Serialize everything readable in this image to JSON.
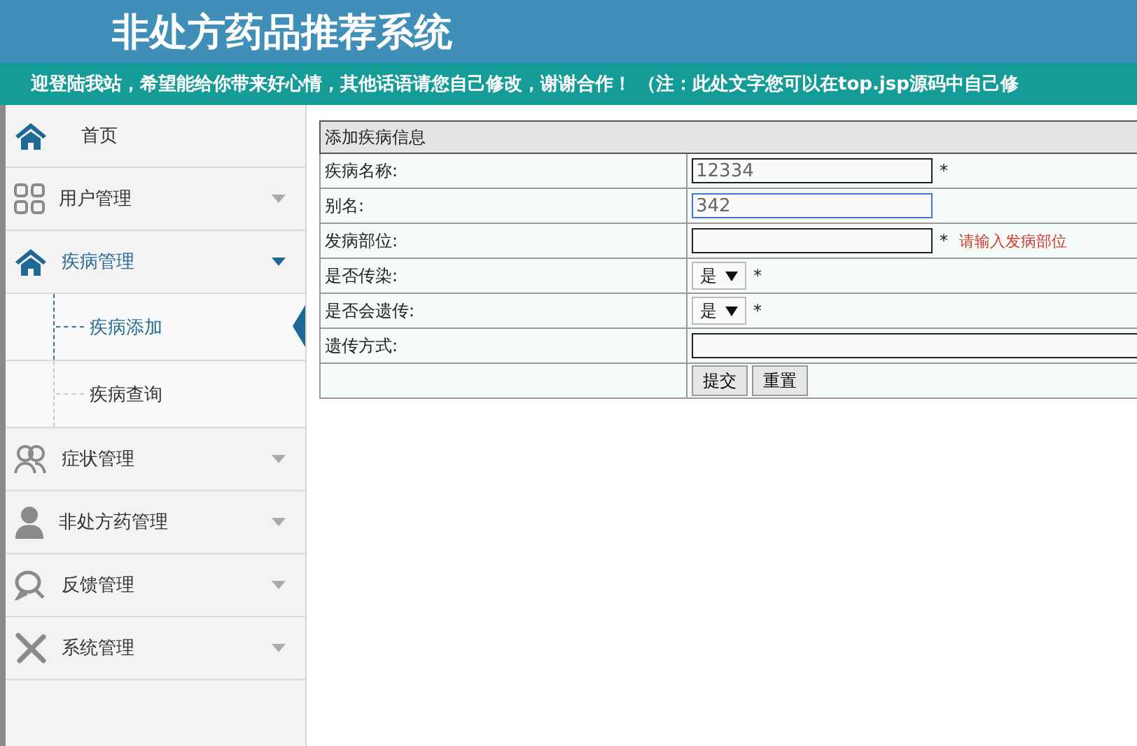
{
  "header": {
    "title": "非处方药品推荐系统",
    "notice": "迎登陆我站，希望能给你带来好心情，其他话语请您自己修改，谢谢合作！ （注：此处文字您可以在top.jsp源码中自己修"
  },
  "sidebar": {
    "items": [
      {
        "kind": "link",
        "label": "首页"
      },
      {
        "kind": "group",
        "label": "用户管理",
        "expanded": false
      },
      {
        "kind": "group",
        "label": "疾病管理",
        "expanded": true,
        "children": [
          {
            "label": "疾病添加",
            "selected": true
          },
          {
            "label": "疾病查询",
            "selected": false
          }
        ]
      },
      {
        "kind": "group",
        "label": "症状管理",
        "expanded": false
      },
      {
        "kind": "group",
        "label": "非处方药管理",
        "expanded": false
      },
      {
        "kind": "group",
        "label": "反馈管理",
        "expanded": false
      },
      {
        "kind": "group",
        "label": "系统管理",
        "expanded": false
      }
    ]
  },
  "form": {
    "title": "添加疾病信息",
    "rows": [
      {
        "kind": "text",
        "label": "疾病名称:",
        "value": "12334",
        "focused": false,
        "required": "*"
      },
      {
        "kind": "text",
        "label": "别名:",
        "value": "342",
        "focused": true
      },
      {
        "kind": "text",
        "label": "发病部位:",
        "focused": false,
        "required": "*",
        "error": "请输入发病部位"
      },
      {
        "kind": "select",
        "label": "是否传染:",
        "value": "是",
        "required": "*"
      },
      {
        "kind": "select",
        "label": "是否会遗传:",
        "value": "是",
        "required": "*"
      },
      {
        "kind": "wide",
        "label": "遗传方式:"
      },
      {
        "kind": "buttons",
        "buttons": [
          "提交",
          "重置"
        ]
      }
    ]
  }
}
